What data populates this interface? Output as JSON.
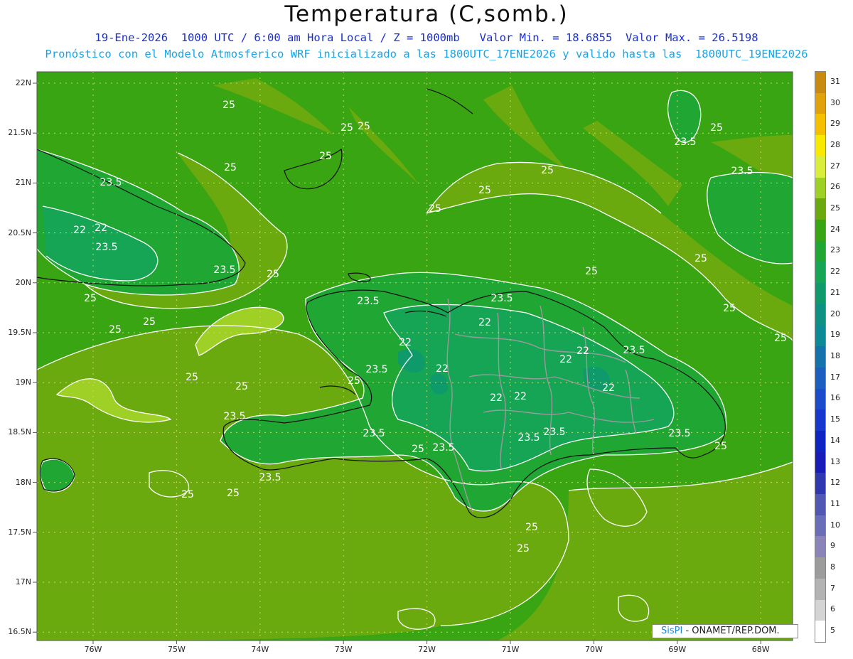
{
  "header": {
    "title": "Temperatura (C,somb.)",
    "subtitle": "19-Ene-2026  1000 UTC / 6:00 am Hora Local / Z = 1000mb   Valor Min. = 18.6855  Valor Max. = 26.5198",
    "subtitle2": "Pronóstico con el Modelo Atmosferico WRF inicializado a las 1800UTC_17ENE2026 y valido hasta las  1800UTC_19ENE2026"
  },
  "axes": {
    "lat_labels": [
      "22N",
      "21.5N",
      "21N",
      "20.5N",
      "20N",
      "19.5N",
      "19N",
      "18.5N",
      "18N",
      "17.5N",
      "17N",
      "16.5N"
    ],
    "lon_labels": [
      "76W",
      "75W",
      "74W",
      "73W",
      "72W",
      "71W",
      "70W",
      "69W",
      "68W"
    ]
  },
  "contour_labels": {
    "values": [
      "25",
      "25",
      "25",
      "25",
      "25",
      "25",
      "25",
      "25",
      "25",
      "25",
      "25",
      "25",
      "25",
      "25",
      "25",
      "25",
      "25",
      "25",
      "25",
      "25",
      "25",
      "25",
      "25",
      "25",
      "25",
      "25",
      "23.5",
      "23.5",
      "23.5",
      "23.5",
      "23.5",
      "23.5",
      "23.5",
      "23.5",
      "23.5",
      "23.5",
      "23.5",
      "23.5",
      "23.5",
      "23.5",
      "23.5",
      "23.5",
      "22",
      "22",
      "22",
      "22",
      "22",
      "22",
      "22",
      "22",
      "22",
      "22"
    ]
  },
  "colorbar": {
    "labels": [
      "31",
      "30",
      "29",
      "28",
      "27",
      "26",
      "25",
      "24",
      "23",
      "22",
      "21",
      "20",
      "19",
      "18",
      "17",
      "16",
      "15",
      "14",
      "13",
      "12",
      "11",
      "10",
      "9",
      "8",
      "7",
      "6",
      "5"
    ],
    "colors": [
      "#c98a10",
      "#e2a00a",
      "#f4c000",
      "#f7ea00",
      "#d9ee3a",
      "#9fd025",
      "#6aaa0e",
      "#3aa512",
      "#20a632",
      "#15a555",
      "#0f9a6c",
      "#0c9182",
      "#0c8a96",
      "#1473ad",
      "#1b5fc0",
      "#1b4ccb",
      "#1638cc",
      "#0f25c3",
      "#1a1cb8",
      "#3038b0",
      "#5058b3",
      "#6a6eb8",
      "#8a84b8",
      "#9c9c9c",
      "#b3b3b3",
      "#d4d4d4",
      "#ffffff"
    ]
  },
  "credit": {
    "brand": "SisPI",
    "org": " - ONAMET/REP.DOM."
  }
}
